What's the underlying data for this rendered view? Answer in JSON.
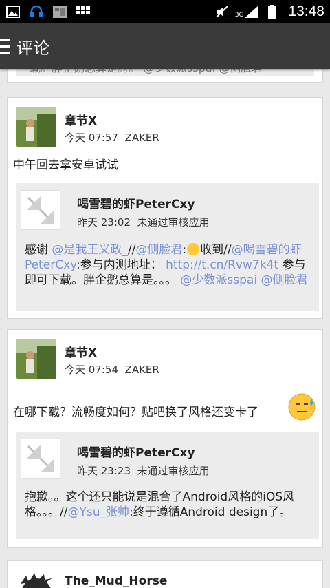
{
  "status_bar": {
    "network": "3G",
    "time": "13:48"
  },
  "header": {
    "title": "评论"
  },
  "top_partial": {
    "text": "载。胖企鹅总算是。。。 @少数派sspai @侧脸君"
  },
  "comments": [
    {
      "author": "章节X",
      "time": "今天 07:57",
      "source": "ZAKER",
      "text": "中午回去拿安卓试试",
      "quote": {
        "author": "喝雪碧的虾PeterCxy",
        "time": "昨天 23:02",
        "source": "未通过审核应用",
        "segments": [
          {
            "t": "感谢 ",
            "m": false
          },
          {
            "t": "@是我王义政_",
            "m": true
          },
          {
            "t": "//",
            "m": false
          },
          {
            "t": "@侧脸君",
            "m": true
          },
          {
            "t": ":",
            "m": false
          },
          {
            "t": "emoji",
            "e": true
          },
          {
            "t": "收到//",
            "m": false
          },
          {
            "t": "@喝雪碧的虾PeterCxy",
            "m": true
          },
          {
            "t": ":参与内测地址： ",
            "m": false
          },
          {
            "t": "http://t.cn/Rvw7k4t",
            "m": true
          },
          {
            "t": " 参与即可下载。胖企鹅总算是。。。 ",
            "m": false
          },
          {
            "t": "@少数派sspai",
            "m": true
          },
          {
            "t": " ",
            "m": false
          },
          {
            "t": "@侧脸君",
            "m": true
          }
        ]
      }
    },
    {
      "author": "章节X",
      "time": "今天 07:54",
      "source": "ZAKER",
      "text": "在哪下载？流畅度如何？贴吧换了风格还变卡了",
      "quote": {
        "author": "喝雪碧的虾PeterCxy",
        "time": "昨天 23:23",
        "source": "未通过审核应用",
        "segments": [
          {
            "t": "抱歉。。这个还只能说是混合了Android风格的iOS风格。。。//",
            "m": false
          },
          {
            "t": "@Ysu_张帅",
            "m": true
          },
          {
            "t": ":终于遵循Android design了。",
            "m": false
          }
        ]
      }
    },
    {
      "author": "The_Mud_Horse"
    }
  ]
}
